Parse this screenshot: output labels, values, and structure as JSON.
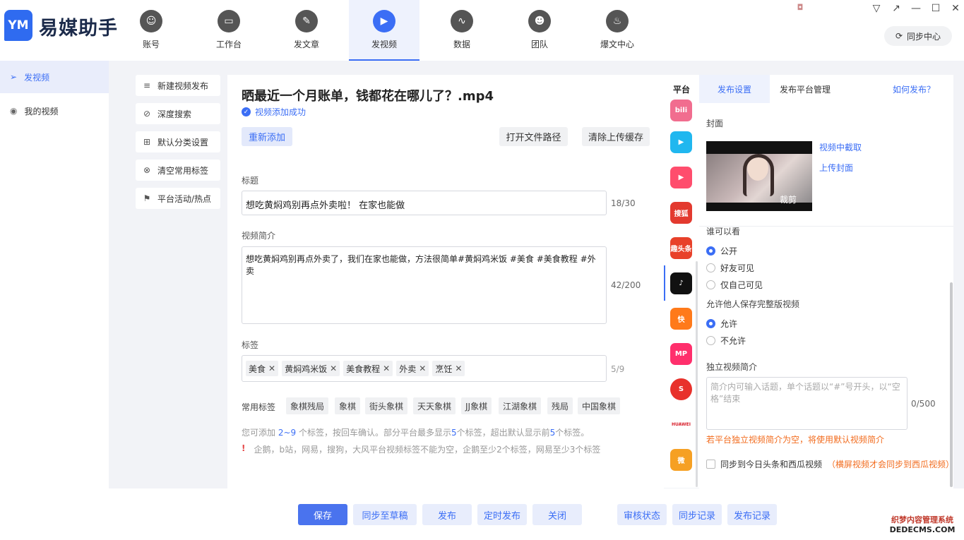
{
  "app": {
    "name": "易媒助手",
    "logo_mark": "YM"
  },
  "nav": [
    {
      "label": "账号",
      "icon": "user-icon",
      "glyph": "☺"
    },
    {
      "label": "工作台",
      "icon": "monitor-icon",
      "glyph": "▭"
    },
    {
      "label": "发文章",
      "icon": "feather-icon",
      "glyph": "✎"
    },
    {
      "label": "发视频",
      "icon": "play-icon",
      "glyph": "▶",
      "active": true
    },
    {
      "label": "数据",
      "icon": "chart-icon",
      "glyph": "∿"
    },
    {
      "label": "团队",
      "icon": "team-icon",
      "glyph": "☻"
    },
    {
      "label": "爆文中心",
      "icon": "flame-icon",
      "glyph": "♨"
    }
  ],
  "window": {
    "sync_center": "同步中心"
  },
  "sidebar": [
    {
      "label": "发视频",
      "icon": "send-icon",
      "active": true
    },
    {
      "label": "我的视频",
      "icon": "video-circle-icon"
    }
  ],
  "tools": [
    {
      "label": "新建视频发布",
      "icon": "list-plus-icon"
    },
    {
      "label": "深度搜索",
      "icon": "search-icon"
    },
    {
      "label": "默认分类设置",
      "icon": "grid-icon"
    },
    {
      "label": "清空常用标签",
      "icon": "tag-clear-icon"
    },
    {
      "label": "平台活动/热点",
      "icon": "flag-icon"
    }
  ],
  "main": {
    "video_title": "晒最近一个月账单，钱都花在哪儿了？.mp4",
    "upload_status": "视频添加成功",
    "readd": "重新添加",
    "open_path": "打开文件路径",
    "clear_cache": "清除上传缓存",
    "title_label": "标题",
    "title_value": "想吃黄焖鸡别再点外卖啦！   在家也能做",
    "title_count": "18/30",
    "desc_label": "视频简介",
    "desc_value": "想吃黄焖鸡别再点外卖了，我们在家也能做，方法很简单#黄焖鸡米饭 #美食 #美食教程 #外卖",
    "desc_count": "42/200",
    "tags_label": "标签",
    "tags": [
      "美食",
      "黄焖鸡米饭",
      "美食教程",
      "外卖",
      "烹饪"
    ],
    "tags_count": "5/9",
    "common_label": "常用标签",
    "common_tags": [
      "象棋残局",
      "象棋",
      "街头象棋",
      "天天象棋",
      "JJ象棋",
      "江湖象棋",
      "残局",
      "中国象棋"
    ],
    "hint_pre": "您可添加 ",
    "hint_range": "2~9",
    "hint_mid": " 个标签，按回车确认。部分平台最多显示",
    "hint_n1": "5",
    "hint_mid2": "个标签，超出默认显示前",
    "hint_n2": "5",
    "hint_post": "个标签。",
    "warning": "企鹅，b站，网易，搜狗，大风平台视频标签不能为空，企鹅至少2个标签，网易至少3个标签"
  },
  "platforms": {
    "header": "平台",
    "items": [
      {
        "name": "bilibili",
        "text": "bili",
        "color": "#f16d8f"
      },
      {
        "name": "tencent-video",
        "text": "▶",
        "color": "#20b7ef"
      },
      {
        "name": "iqiyi-video",
        "text": "▶",
        "color": "#ff4d6d"
      },
      {
        "name": "sohu-video",
        "text": "搜狐",
        "color": "#e33a2f"
      },
      {
        "name": "qutoutiao",
        "text": "趣头条",
        "color": "#e8412a"
      },
      {
        "name": "douyin",
        "text": "♪",
        "color": "#111111"
      },
      {
        "name": "kuaishou",
        "text": "快",
        "color": "#ff7a1a"
      },
      {
        "name": "meipai",
        "text": "MP",
        "color": "#ff2f6c"
      },
      {
        "name": "sohu",
        "text": "S",
        "color": "#e8312b"
      },
      {
        "name": "huawei",
        "text": "HUAWEI",
        "color": "#d81e2a"
      },
      {
        "name": "weibo",
        "text": "微",
        "color": "#f6a023"
      }
    ]
  },
  "settings": {
    "tab_publish": "发布设置",
    "tab_manage": "发布平台管理",
    "howto": "如何发布？",
    "cover_label": "封面",
    "capture": "视频中截取",
    "upload_cover": "上传封面",
    "crop": "裁剪",
    "visibility_label": "谁可以看",
    "vis_options": [
      "公开",
      "好友可见",
      "仅自己可见"
    ],
    "save_label": "允许他人保存完整版视频",
    "save_options": [
      "允许",
      "不允许"
    ],
    "indep_label": "独立视频简介",
    "indep_placeholder": "简介内可输入话题，单个话题以“#”号开头，以“空格”结束",
    "indep_count": "0/500",
    "indep_note": "若平台独立视频简介为空，将使用默认视频简介",
    "sync_toutiao": "同步到今日头条和西瓜视频",
    "sync_note": "（横屏视频才会同步到西瓜视频）"
  },
  "bottom": {
    "save": "保存",
    "draft": "同步至草稿",
    "publish": "发布",
    "timed": "定时发布",
    "close": "关闭",
    "audit": "审核状态",
    "sync_log": "同步记录",
    "pub_log": "发布记录"
  },
  "watermark": {
    "line1": "织梦内容管理系统",
    "line2": "DEDECMS.COM"
  }
}
